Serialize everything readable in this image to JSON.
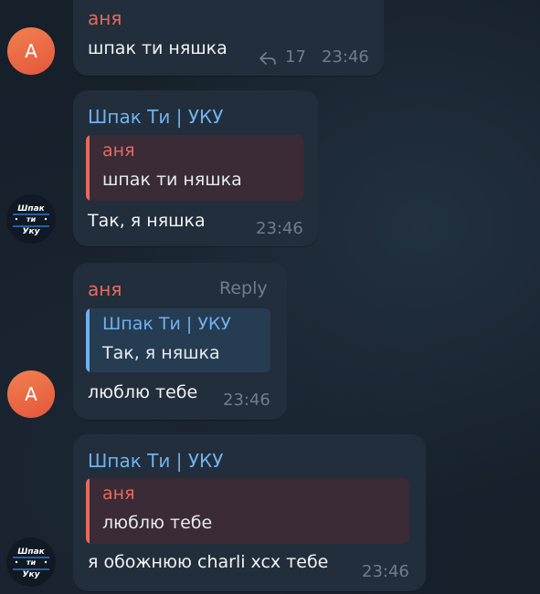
{
  "messages": [
    {
      "sender": "аня",
      "text": "шпак ти няшка",
      "reply_count": "17",
      "time": "23:46",
      "avatar_letter": "A"
    },
    {
      "sender": "Шпак Ти | УКУ",
      "quote": {
        "name": "аня",
        "text": "шпак ти няшка"
      },
      "text": "Так, я няшка",
      "time": "23:46",
      "avatar_logo_lines": [
        "Шпак",
        "ти",
        "Уку"
      ]
    },
    {
      "sender": "аня",
      "reply_label": "Reply",
      "quote": {
        "name": "Шпак Ти | УКУ",
        "text": "Так, я няшка"
      },
      "text": "люблю тебе",
      "time": "23:46",
      "avatar_letter": "A"
    },
    {
      "sender": "Шпак Ти | УКУ",
      "quote": {
        "name": "аня",
        "text": "люблю тебе"
      },
      "text": "я обожнюю charli xcx тебе",
      "time": "23:46",
      "avatar_logo_lines": [
        "Шпак",
        "ти",
        "Уку"
      ]
    }
  ],
  "colors": {
    "background": "#16202b",
    "bubble": "#222e3b",
    "name_red": "#e46a5e",
    "name_blue": "#6fb1ef",
    "meta": "#6e7d8c",
    "avatar_orange": "#ea6a45"
  },
  "icons": [
    "reply-arrow-icon"
  ]
}
